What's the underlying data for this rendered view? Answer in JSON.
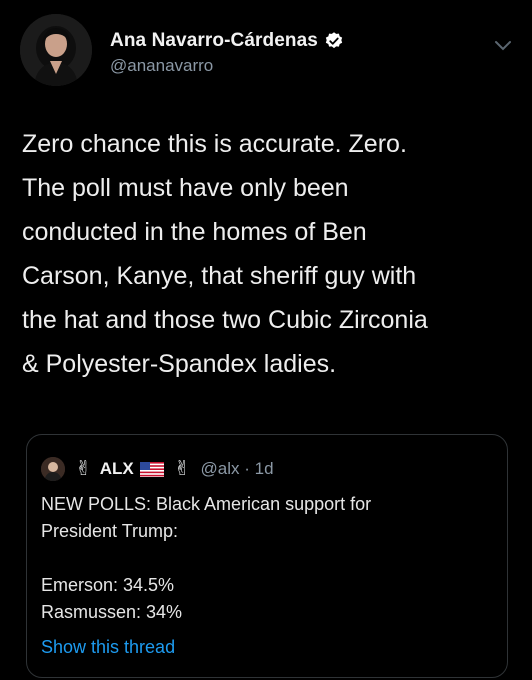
{
  "author": {
    "name": "Ana Navarro-Cárdenas",
    "handle": "@ananavarro",
    "avatar_icon": "profile-photo",
    "verified_icon": "verified-badge-icon"
  },
  "tweet": {
    "text": "Zero chance this is accurate. Zero.\nThe poll must have only been\nconducted in the homes of Ben\nCarson, Kanye, that sheriff guy with\nthe hat and those two Cubic Zirconia\n& Polyester-Spandex ladies."
  },
  "quote": {
    "victory_emoji": "✌",
    "name": "ALX",
    "flag_icon": "us-flag-icon",
    "handle_time": "@alx · 1d",
    "lines": [
      "NEW POLLS: Black American support for",
      "President Trump:",
      "",
      "Emerson: 34.5%",
      "Rasmussen: 34%"
    ],
    "show_thread": "Show this thread"
  },
  "colors": {
    "background": "#000000",
    "link": "#1d9bf0",
    "secondary_text": "#8b98a5",
    "verified": "#ffffff"
  }
}
